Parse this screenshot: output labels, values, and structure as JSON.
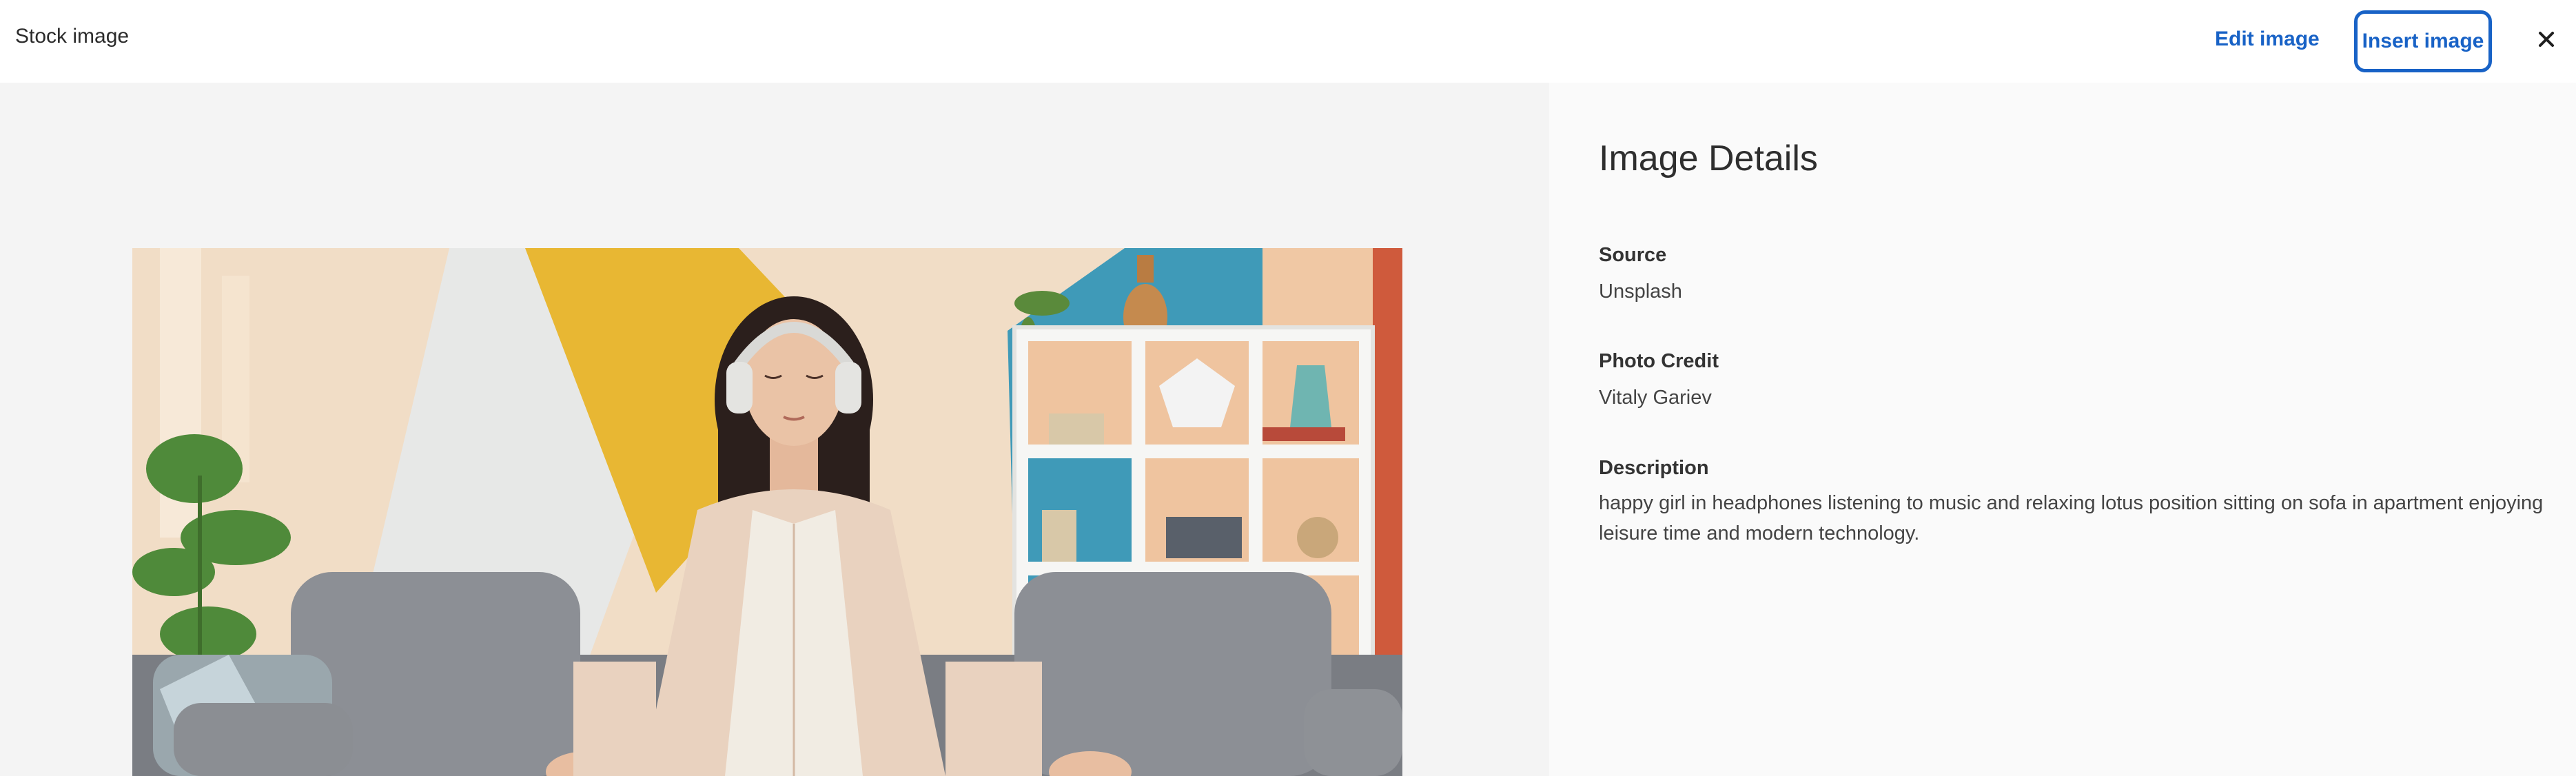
{
  "header": {
    "title": "Stock image",
    "edit_label": "Edit image",
    "insert_label": "Insert image",
    "close_icon": "close-icon"
  },
  "details": {
    "heading": "Image Details",
    "source_label": "Source",
    "source_value": "Unsplash",
    "credit_label": "Photo Credit",
    "credit_value": "Vitaly Gariev",
    "description_label": "Description",
    "description_value": "happy girl in headphones listening to music and relaxing lotus position sitting on sofa in apartment enjoying leisure time and modern technology."
  },
  "colors": {
    "accent": "#1862c6",
    "preview_bg": "#f4f4f4",
    "details_bg": "#fafafa"
  }
}
